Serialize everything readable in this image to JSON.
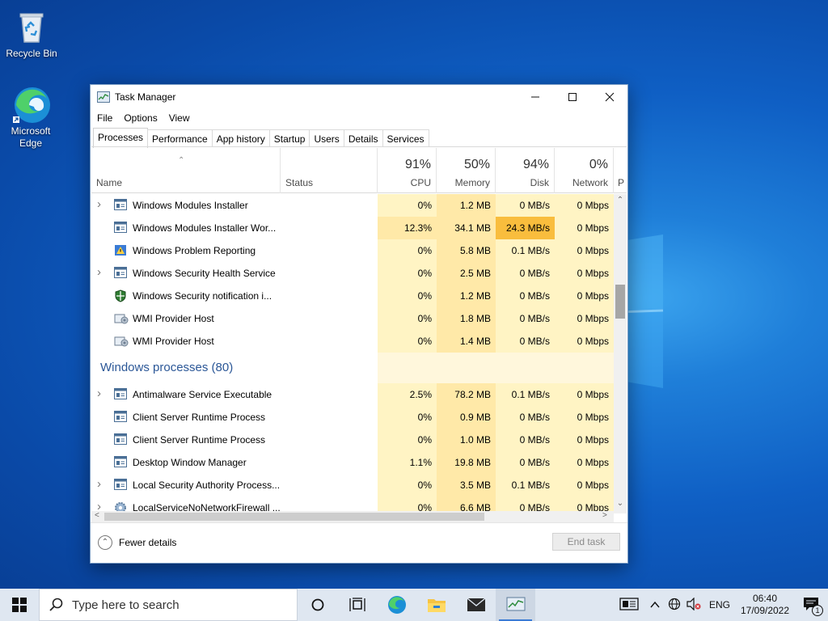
{
  "desktop": {
    "icons": [
      {
        "label": "Recycle Bin"
      },
      {
        "label": "Microsoft\nEdge"
      }
    ]
  },
  "window": {
    "title": "Task Manager",
    "menu": [
      "File",
      "Options",
      "View"
    ],
    "tabs": [
      "Processes",
      "Performance",
      "App history",
      "Startup",
      "Users",
      "Details",
      "Services"
    ],
    "active_tab": "Processes",
    "columns": {
      "name": "Name",
      "status": "Status",
      "cpu": {
        "pct": "91%",
        "label": "CPU"
      },
      "memory": {
        "pct": "50%",
        "label": "Memory"
      },
      "disk": {
        "pct": "94%",
        "label": "Disk"
      },
      "network": {
        "pct": "0%",
        "label": "Network"
      },
      "power": "P"
    },
    "rows_top": [
      {
        "name": "Windows Modules Installer",
        "expand": true,
        "icon": "service-icon",
        "cpu": "0%",
        "mem": "1.2 MB",
        "disk": "0 MB/s",
        "net": "0 Mbps",
        "cpu_hot": false,
        "mem_hot": false,
        "disk_hot": false
      },
      {
        "name": "Windows Modules Installer Wor...",
        "expand": false,
        "icon": "service-icon",
        "cpu": "12.3%",
        "mem": "34.1 MB",
        "disk": "24.3 MB/s",
        "net": "0 Mbps",
        "cpu_hot": true,
        "mem_hot": true,
        "disk_hot": true
      },
      {
        "name": "Windows Problem Reporting",
        "expand": false,
        "icon": "problem-reporting-icon",
        "cpu": "0%",
        "mem": "5.8 MB",
        "disk": "0.1 MB/s",
        "net": "0 Mbps",
        "cpu_hot": false,
        "mem_hot": false,
        "disk_hot": false
      },
      {
        "name": "Windows Security Health Service",
        "expand": true,
        "icon": "service-icon",
        "cpu": "0%",
        "mem": "2.5 MB",
        "disk": "0 MB/s",
        "net": "0 Mbps",
        "cpu_hot": false,
        "mem_hot": false,
        "disk_hot": false
      },
      {
        "name": "Windows Security notification i...",
        "expand": false,
        "icon": "shield-icon",
        "cpu": "0%",
        "mem": "1.2 MB",
        "disk": "0 MB/s",
        "net": "0 Mbps",
        "cpu_hot": false,
        "mem_hot": false,
        "disk_hot": false
      },
      {
        "name": "WMI Provider Host",
        "expand": false,
        "icon": "wmi-icon",
        "cpu": "0%",
        "mem": "1.8 MB",
        "disk": "0 MB/s",
        "net": "0 Mbps",
        "cpu_hot": false,
        "mem_hot": false,
        "disk_hot": false
      },
      {
        "name": "WMI Provider Host",
        "expand": false,
        "icon": "wmi-icon",
        "cpu": "0%",
        "mem": "1.4 MB",
        "disk": "0 MB/s",
        "net": "0 Mbps",
        "cpu_hot": false,
        "mem_hot": false,
        "disk_hot": false
      }
    ],
    "group_label": "Windows processes (80)",
    "rows_bottom": [
      {
        "name": "Antimalware Service Executable",
        "expand": true,
        "icon": "service-icon",
        "cpu": "2.5%",
        "mem": "78.2 MB",
        "disk": "0.1 MB/s",
        "net": "0 Mbps",
        "cpu_hot": false,
        "mem_hot": false,
        "disk_hot": false
      },
      {
        "name": "Client Server Runtime Process",
        "expand": false,
        "icon": "service-icon",
        "cpu": "0%",
        "mem": "0.9 MB",
        "disk": "0 MB/s",
        "net": "0 Mbps",
        "cpu_hot": false,
        "mem_hot": false,
        "disk_hot": false
      },
      {
        "name": "Client Server Runtime Process",
        "expand": false,
        "icon": "service-icon",
        "cpu": "0%",
        "mem": "1.0 MB",
        "disk": "0 MB/s",
        "net": "0 Mbps",
        "cpu_hot": false,
        "mem_hot": false,
        "disk_hot": false
      },
      {
        "name": "Desktop Window Manager",
        "expand": false,
        "icon": "service-icon",
        "cpu": "1.1%",
        "mem": "19.8 MB",
        "disk": "0 MB/s",
        "net": "0 Mbps",
        "cpu_hot": false,
        "mem_hot": false,
        "disk_hot": false
      },
      {
        "name": "Local Security Authority Process...",
        "expand": true,
        "icon": "service-icon",
        "cpu": "0%",
        "mem": "3.5 MB",
        "disk": "0.1 MB/s",
        "net": "0 Mbps",
        "cpu_hot": false,
        "mem_hot": false,
        "disk_hot": false
      },
      {
        "name": "LocalServiceNoNetworkFirewall ...",
        "expand": true,
        "icon": "gear-icon",
        "cpu": "0%",
        "mem": "6.6 MB",
        "disk": "0 MB/s",
        "net": "0 Mbps",
        "cpu_hot": false,
        "mem_hot": false,
        "disk_hot": false
      }
    ],
    "footer": {
      "fewer_details": "Fewer details",
      "end_task": "End task"
    }
  },
  "taskbar": {
    "search_placeholder": "Type here to search",
    "lang": "ENG",
    "time": "06:40",
    "date": "17/09/2022",
    "notification_count": "1"
  },
  "colors": {
    "cell_light": "#fff4c4",
    "cell_mid": "#ffe9a8",
    "cell_hot": "#f9bd3d",
    "group_text": "#2b5797",
    "taskbar_bg": "#dfe7f1"
  }
}
